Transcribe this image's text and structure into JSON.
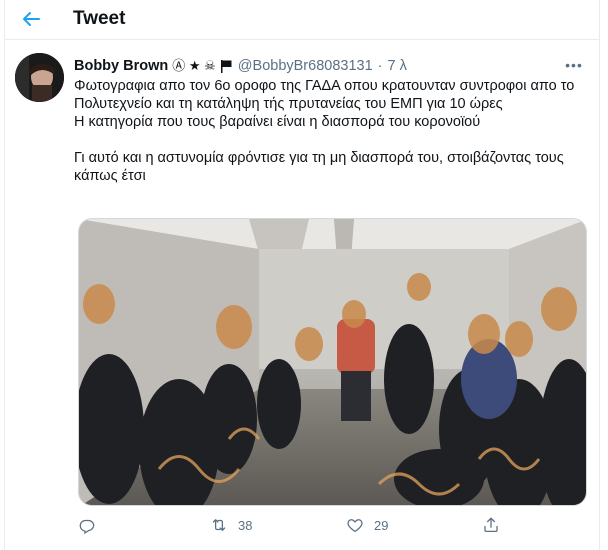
{
  "header": {
    "title": "Tweet"
  },
  "tweet": {
    "author_name": "Bobby Brown",
    "name_emojis": "Ⓐ ★ ☠",
    "handle": "@BobbyBr68083131",
    "separator": "·",
    "time": "7 λ",
    "more": "•••",
    "lines": [
      "Φωτογραφια απο τον 6ο οροφο της ΓΑΔΑ οπου κρατουνταν συντροφοι απο το Πολυτεχνείο και τη κατάληψη τής πρυτανείας του ΕΜΠ για 10 ώρες",
      "Η κατηγορία που τους βαραίνει είναι η διασπορά του κορονοϊού",
      "Γι αυτό και η αστυνομία φρόντισε για τη μη διασπορά του, στοιβάζοντας τους κάπως έτσι"
    ]
  },
  "actions": {
    "replies": "",
    "retweets": "38",
    "likes": "29"
  },
  "colors": {
    "accent": "#1da1f2",
    "muted": "#5b7083",
    "border": "#e6ecf0"
  }
}
